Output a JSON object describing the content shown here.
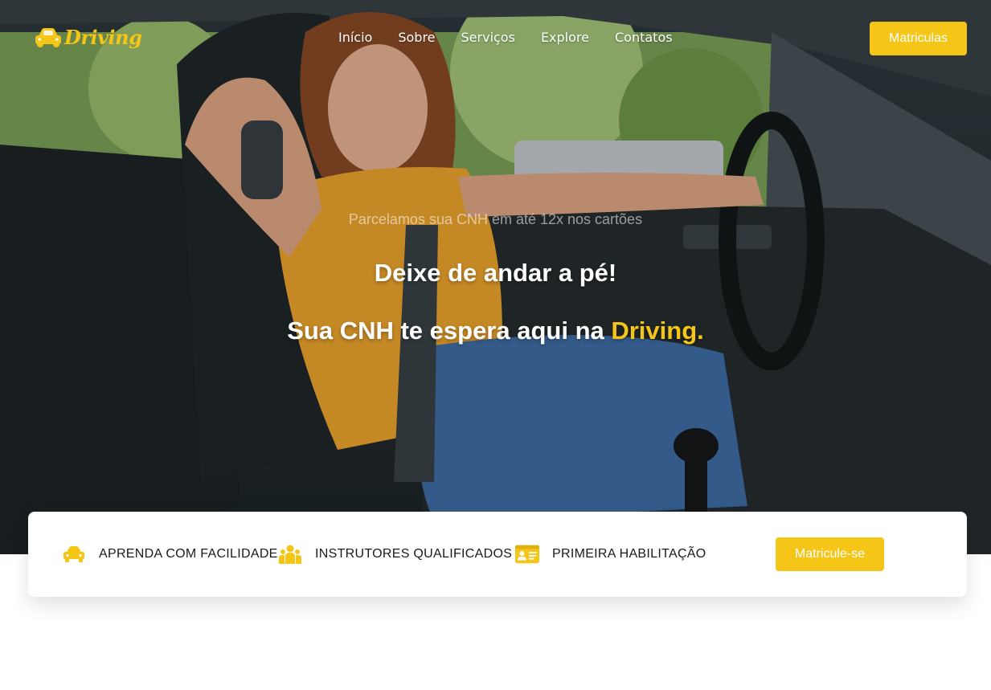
{
  "brand": {
    "name": "Driving",
    "icon": "car-icon",
    "color": "#f5c518"
  },
  "nav": {
    "items": [
      {
        "label": "Início"
      },
      {
        "label": "Sobre"
      },
      {
        "label": "Serviços"
      },
      {
        "label": "Explore"
      },
      {
        "label": "Contatos"
      }
    ],
    "cta_label": "Matriculas"
  },
  "hero": {
    "subtitle": "Parcelamos sua CNH em até 12x nos cartões",
    "headline": "Deixe de andar a pé!",
    "tagline_prefix": "Sua CNH te espera aqui na ",
    "tagline_brand": "Driving."
  },
  "features": {
    "items": [
      {
        "icon": "car-icon",
        "label": "APRENDA COM FACILIDADE"
      },
      {
        "icon": "users-icon",
        "label": "INSTRUTORES QUALIFICADOS"
      },
      {
        "icon": "id-card-icon",
        "label": "PRIMEIRA HABILITAÇÃO"
      }
    ],
    "cta_label": "Matricule-se"
  },
  "colors": {
    "accent": "#f5c518",
    "text_dark": "#1a1a1a",
    "white": "#ffffff"
  }
}
